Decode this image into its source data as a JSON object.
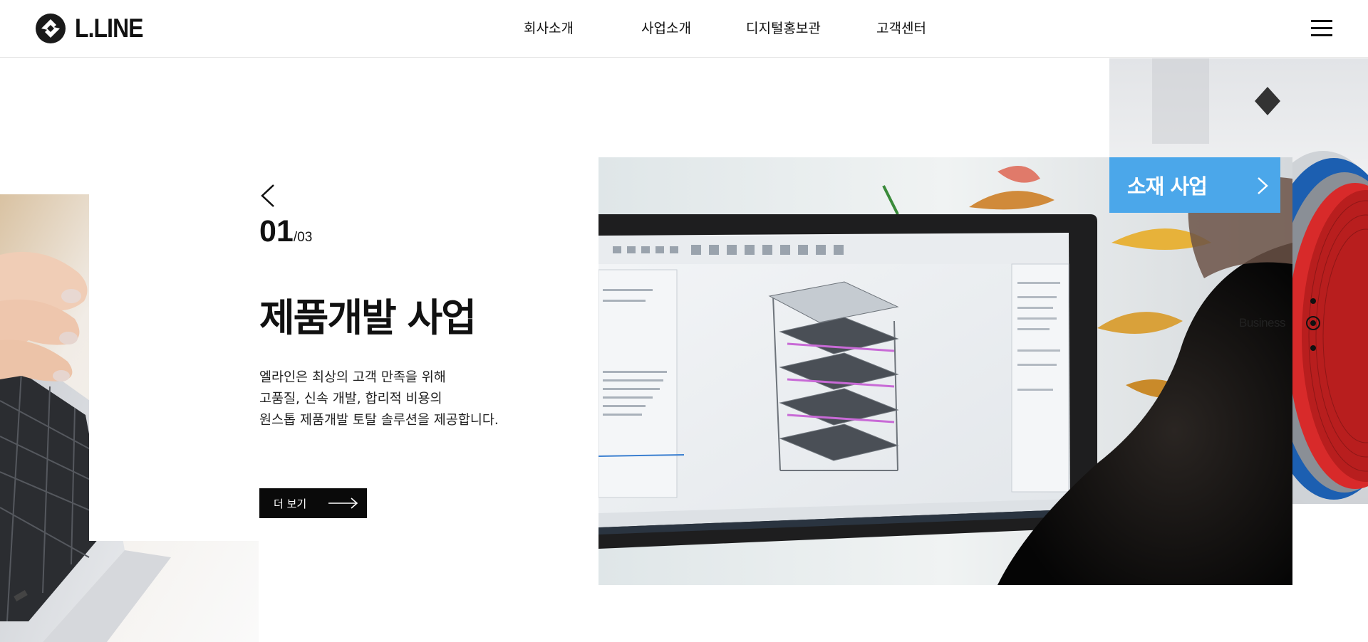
{
  "header": {
    "logo_text": "L.LINE",
    "nav": [
      {
        "label": "회사소개"
      },
      {
        "label": "사업소개"
      },
      {
        "label": "디지털홍보관"
      },
      {
        "label": "고객센터"
      }
    ]
  },
  "slide": {
    "current": "01",
    "total": "/03",
    "title": "제품개발 사업",
    "description": [
      "엘라인은 최상의 고객 만족을 위해",
      "고품질, 신속 개발, 합리적 비용의",
      "원스톱 제품개발 토탈 솔루션을 제공합니다."
    ],
    "more_label": "더 보기"
  },
  "next_slide": {
    "label": "소재 사업"
  },
  "side_nav": {
    "label": "Business"
  },
  "colors": {
    "accent": "#4ba7ea",
    "button_bg": "#0a0a0a",
    "text": "#111111"
  },
  "icons": {
    "logo": "l-line-logo-icon",
    "prev": "chevron-left-icon",
    "next": "chevron-right-icon",
    "more": "long-arrow-right-icon",
    "menu": "hamburger-menu-icon"
  }
}
